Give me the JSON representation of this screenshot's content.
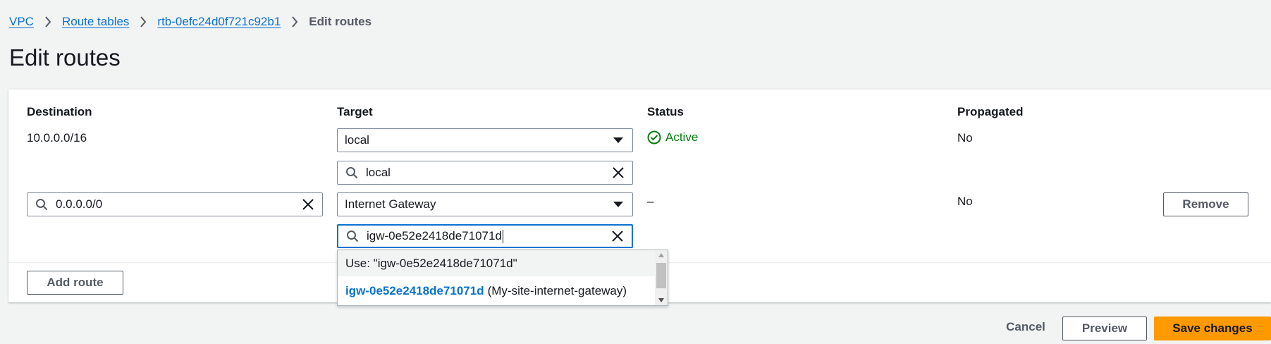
{
  "breadcrumb": {
    "items": [
      "VPC",
      "Route tables",
      "rtb-0efc24d0f721c92b1"
    ],
    "current": "Edit routes"
  },
  "page": {
    "title": "Edit routes"
  },
  "columns": {
    "destination": "Destination",
    "target": "Target",
    "status": "Status",
    "propagated": "Propagated"
  },
  "routes": [
    {
      "destination": "10.0.0.0/16",
      "target_select": "local",
      "target_search": "local",
      "status": "Active",
      "propagated": "No"
    },
    {
      "destination_value": "0.0.0.0/0",
      "target_select": "Internet Gateway",
      "target_search": "igw-0e52e2418de71071d",
      "status": "–",
      "propagated": "No",
      "remove_label": "Remove"
    }
  ],
  "dropdown": {
    "use_option": "Use: \"igw-0e52e2418de71071d\"",
    "option_id": "igw-0e52e2418de71071d",
    "option_name": "(My-site-internet-gateway)"
  },
  "buttons": {
    "add_route": "Add route",
    "cancel": "Cancel",
    "preview": "Preview",
    "save": "Save changes"
  },
  "colors": {
    "link": "#0972d3",
    "status_active": "#037f0c",
    "primary": "#ff9900",
    "focus": "#0972d3"
  },
  "icons": [
    "chevron-right-icon",
    "search-icon",
    "clear-icon",
    "caret-down-icon",
    "check-circle-icon"
  ]
}
